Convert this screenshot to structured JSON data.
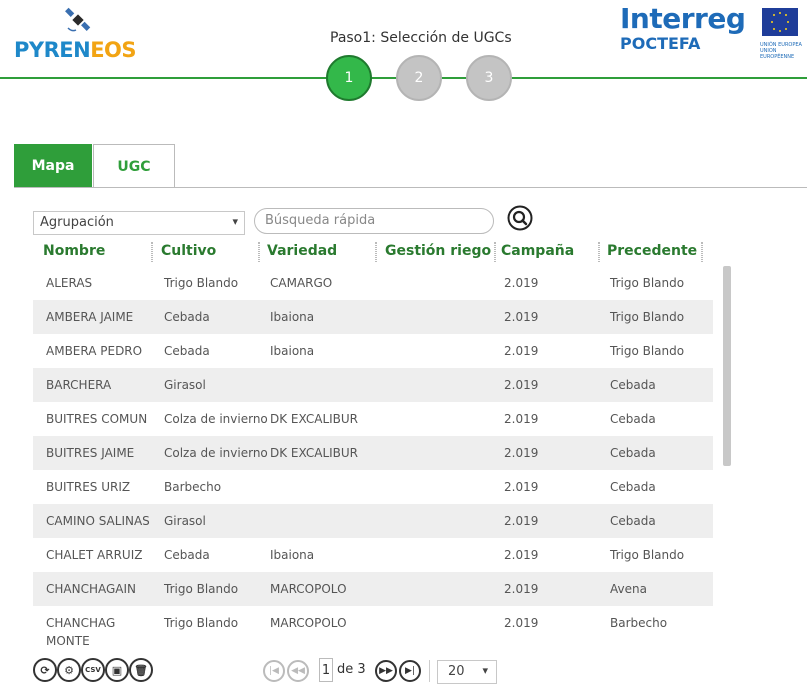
{
  "header": {
    "logo_pyren": "PYREN",
    "logo_eos": "EOS",
    "step_title": "Paso1: Selección de UGCs",
    "steps": [
      "1",
      "2",
      "3"
    ],
    "interreg": "Interreg",
    "poctefa": "POCTEFA",
    "eu_text": "UNIÓN EUROPEA UNION EUROPÉENNE",
    "accent": "#2f9e3a"
  },
  "tabs": [
    {
      "label": "Mapa",
      "active": true
    },
    {
      "label": "UGC",
      "active": false
    }
  ],
  "toolbar": {
    "group_select": "Agrupación",
    "search_placeholder": "Búsqueda rápida"
  },
  "table": {
    "columns": [
      "Nombre",
      "Cultivo",
      "Variedad",
      "Gestión riego",
      "Campaña",
      "Precedente"
    ],
    "rows": [
      [
        "ALERAS",
        "Trigo Blando",
        "CAMARGO",
        "",
        "2.019",
        "Trigo Blando"
      ],
      [
        "AMBERA JAIME",
        "Cebada",
        "Ibaiona",
        "",
        "2.019",
        "Trigo Blando"
      ],
      [
        "AMBERA PEDRO",
        "Cebada",
        "Ibaiona",
        "",
        "2.019",
        "Trigo Blando"
      ],
      [
        "BARCHERA",
        "Girasol",
        "",
        "",
        "2.019",
        "Cebada"
      ],
      [
        "BUITRES COMUN",
        "Colza de invierno",
        "DK EXCALIBUR",
        "",
        "2.019",
        "Cebada"
      ],
      [
        "BUITRES JAIME",
        "Colza de invierno",
        "DK EXCALIBUR",
        "",
        "2.019",
        "Cebada"
      ],
      [
        "BUITRES URIZ",
        "Barbecho",
        "",
        "",
        "2.019",
        "Cebada"
      ],
      [
        "CAMINO SALINAS",
        "Girasol",
        "",
        "",
        "2.019",
        "Cebada"
      ],
      [
        "CHALET ARRUIZ",
        "Cebada",
        "Ibaiona",
        "",
        "2.019",
        "Trigo Blando"
      ],
      [
        "CHANCHAGAIN",
        "Trigo Blando",
        "MARCOPOLO",
        "",
        "2.019",
        "Avena"
      ],
      [
        "CHANCHAG MONTE",
        "Trigo Blando",
        "MARCOPOLO",
        "",
        "2.019",
        "Barbecho"
      ]
    ]
  },
  "pagination": {
    "current_page": "1",
    "of_label": "de 3",
    "per_page": "20",
    "csv_label": "CSV"
  }
}
